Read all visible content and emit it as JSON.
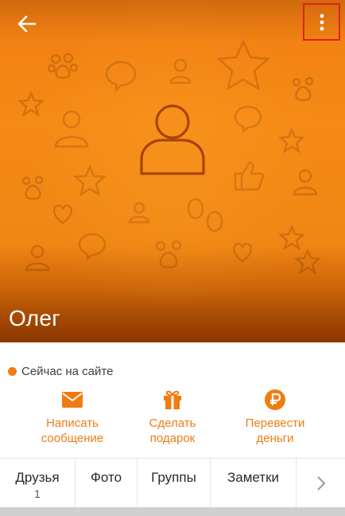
{
  "profile": {
    "name": "Олег",
    "status_text": "Сейчас на сайте"
  },
  "toolbar": {
    "back_icon": "arrow-left-icon",
    "menu_icon": "more-vertical-icon"
  },
  "actions": [
    {
      "label_line1": "Написать",
      "label_line2": "сообщение",
      "icon": "envelope-icon"
    },
    {
      "label_line1": "Сделать",
      "label_line2": "подарок",
      "icon": "gift-icon"
    },
    {
      "label_line1": "Перевести",
      "label_line2": "деньги",
      "icon": "ruble-icon"
    }
  ],
  "tabs": [
    {
      "label": "Друзья",
      "count": "1"
    },
    {
      "label": "Фото",
      "count": ""
    },
    {
      "label": "Группы",
      "count": ""
    },
    {
      "label": "Заметки",
      "count": ""
    }
  ],
  "colors": {
    "accent": "#f07d12",
    "highlight_border": "#e02020"
  }
}
